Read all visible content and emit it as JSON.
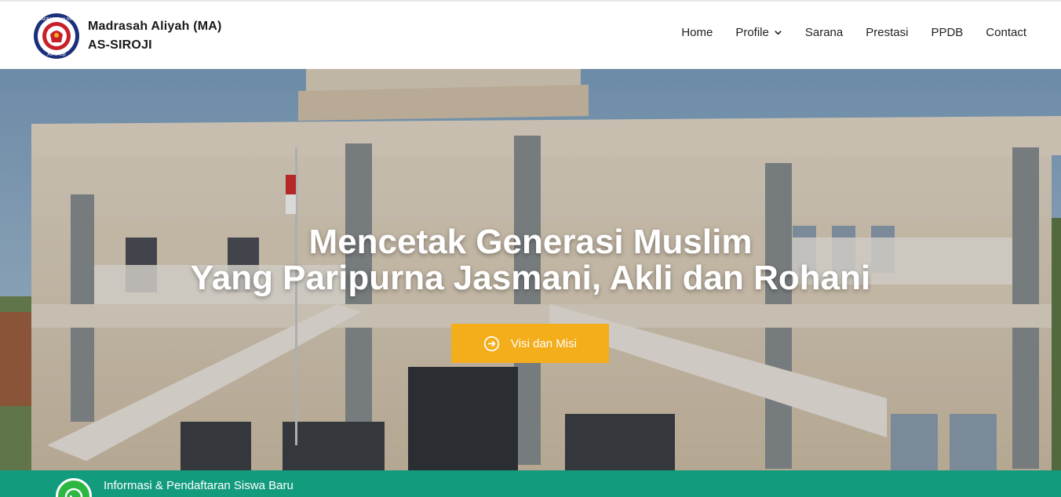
{
  "brand": {
    "line1": "Madrasah Aliyah (MA)",
    "line2": "AS-SIROJI",
    "logo_ring_text": "MADRASAH ALIYAH",
    "logo_bottom_text": "AS-SIROJI"
  },
  "nav": {
    "items": [
      "Home",
      "Profile",
      "Sarana",
      "Prestasi",
      "PPDB",
      "Contact"
    ],
    "profile_icon": "chevron-down-icon"
  },
  "hero": {
    "headline_line1": "Mencetak Generasi Muslim",
    "headline_line2": "Yang Paripurna Jasmani, Akli dan Rohani",
    "cta_label": "Visi dan Misi",
    "cta_icon": "arrow-right-circle-icon"
  },
  "info_bar": {
    "text": "Informasi & Pendaftaran Siswa Baru",
    "icon": "whatsapp-icon"
  },
  "colors": {
    "cta": "#f4ad1b",
    "info_bar": "#139b7e",
    "whatsapp": "#2bb741"
  }
}
